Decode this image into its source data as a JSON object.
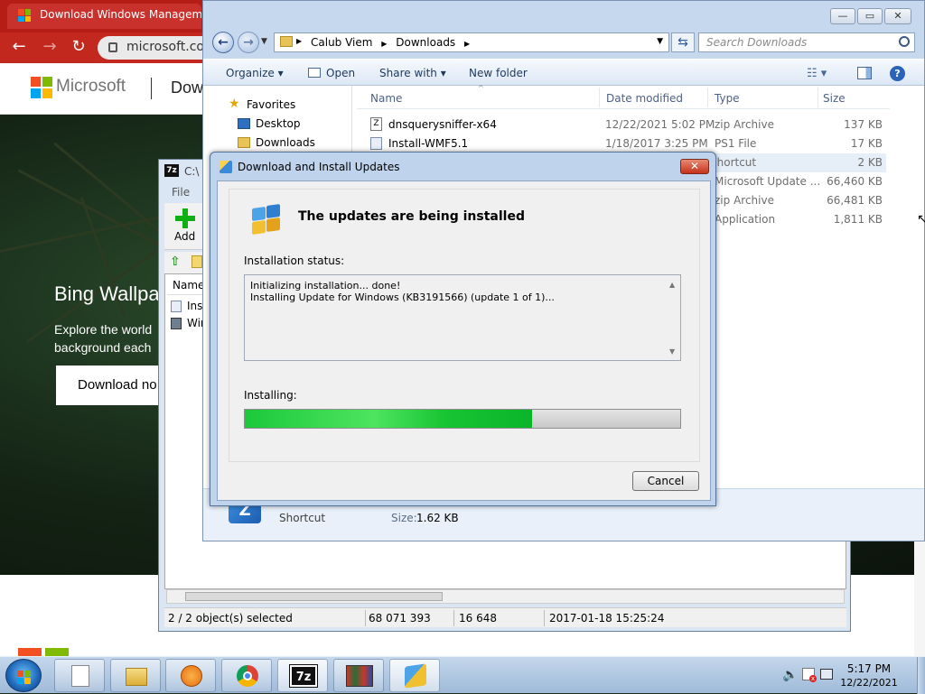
{
  "browser": {
    "tab_title": "Download Windows Management",
    "url": "microsoft.com",
    "brand": "Microsoft",
    "page_heading": "Dow",
    "hero_title": "Bing Wallpa",
    "hero_subtitle": "Explore the world background each",
    "hero_button": "Download no"
  },
  "zip": {
    "title": "C:\\",
    "menu_file": "File",
    "add_label": "Add",
    "col_name": "Name",
    "rows": [
      "Inst",
      "Wir"
    ],
    "status": {
      "selected": "2 / 2 object(s) selected",
      "size": "68 071 393",
      "packed": "16 648",
      "modified": "2017-01-18 15:25:24"
    }
  },
  "explorer": {
    "breadcrumb": [
      "Calub Viem",
      "Downloads"
    ],
    "search_placeholder": "Search Downloads",
    "commands": {
      "organize": "Organize",
      "open": "Open",
      "share_with": "Share with",
      "new_folder": "New folder"
    },
    "nav": {
      "favorites": "Favorites",
      "desktop": "Desktop",
      "downloads": "Downloads"
    },
    "columns": {
      "name": "Name",
      "date": "Date modified",
      "type": "Type",
      "size": "Size"
    },
    "files": [
      {
        "name": "dnsquerysniffer-x64",
        "date": "12/22/2021 5:02 PM",
        "type": "zip Archive",
        "size": "137 KB"
      },
      {
        "name": "Install-WMF5.1",
        "date": "1/18/2017 3:25 PM",
        "type": "PS1 File",
        "size": "17 KB"
      },
      {
        "name": "",
        "date": "",
        "type": "Shortcut",
        "size": "2 KB"
      },
      {
        "name": "",
        "date": "",
        "type": "Microsoft Update ...",
        "size": "66,460 KB"
      },
      {
        "name": "",
        "date": "",
        "type": "zip Archive",
        "size": "66,481 KB"
      },
      {
        "name": "",
        "date": "",
        "type": "Application",
        "size": "1,811 KB"
      }
    ],
    "details": {
      "type": "Shortcut",
      "size_label": "Size:",
      "size_value": "1.62 KB"
    }
  },
  "dialog": {
    "title": "Download and Install Updates",
    "close_glyph": "✕",
    "heading": "The updates are being installed",
    "status_label": "Installation status:",
    "log_line1": "Initializing installation... done!",
    "log_line2": "Installing Update for Windows (KB3191566) (update 1 of 1)...",
    "installing_label": "Installing:",
    "progress_percent": 66,
    "cancel": "Cancel"
  },
  "taskbar": {
    "zip_label": "7z",
    "time": "5:17 PM",
    "date": "12/22/2021",
    "icons": [
      "start-orb-icon",
      "file-icon",
      "file-explorer-icon",
      "media-player-icon",
      "chrome-icon",
      "7zip-icon",
      "photo-viewer-icon",
      "windows-update-icon"
    ]
  },
  "colors": {
    "accent": "#1bc93b",
    "chrome_red": "#b61d17",
    "taskbar": "#9fbad8"
  }
}
